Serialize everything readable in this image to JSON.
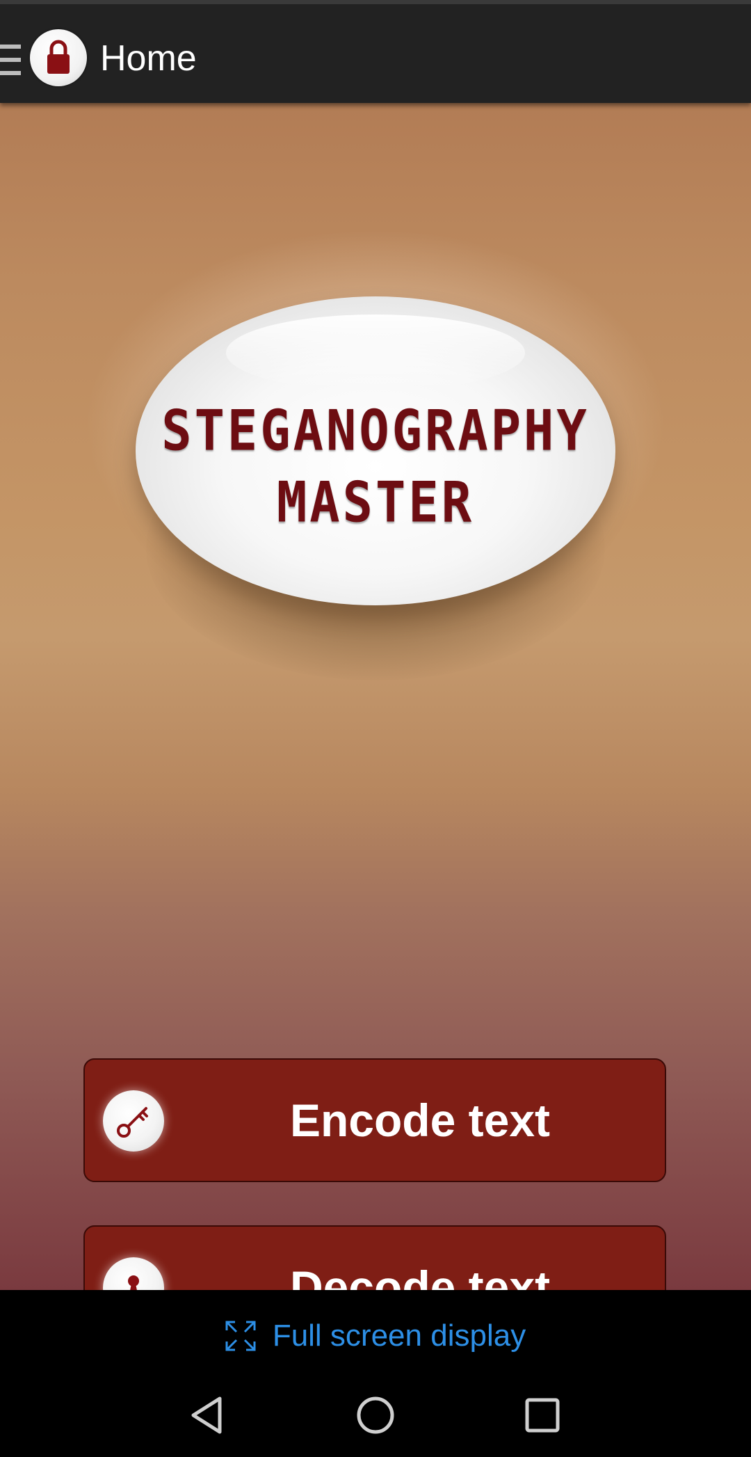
{
  "header": {
    "title": "Home"
  },
  "logo": {
    "line1": "STEGANOGRAPHY",
    "line2": "MASTER"
  },
  "actions": {
    "encode_label": "Encode text",
    "decode_label": "Decode text"
  },
  "footer": {
    "fullscreen_label": "Full screen display"
  },
  "colors": {
    "topbar": "#222222",
    "button": "#7f1e15",
    "logo_text": "#6d0d12",
    "link": "#2d8fe6"
  },
  "icons": {
    "menu": "hamburger-icon",
    "app": "padlock-icon",
    "encode": "key-icon",
    "decode": "keyhole-icon",
    "fullscreen": "expand-icon",
    "nav": [
      "back-icon",
      "home-icon",
      "recents-icon"
    ]
  }
}
